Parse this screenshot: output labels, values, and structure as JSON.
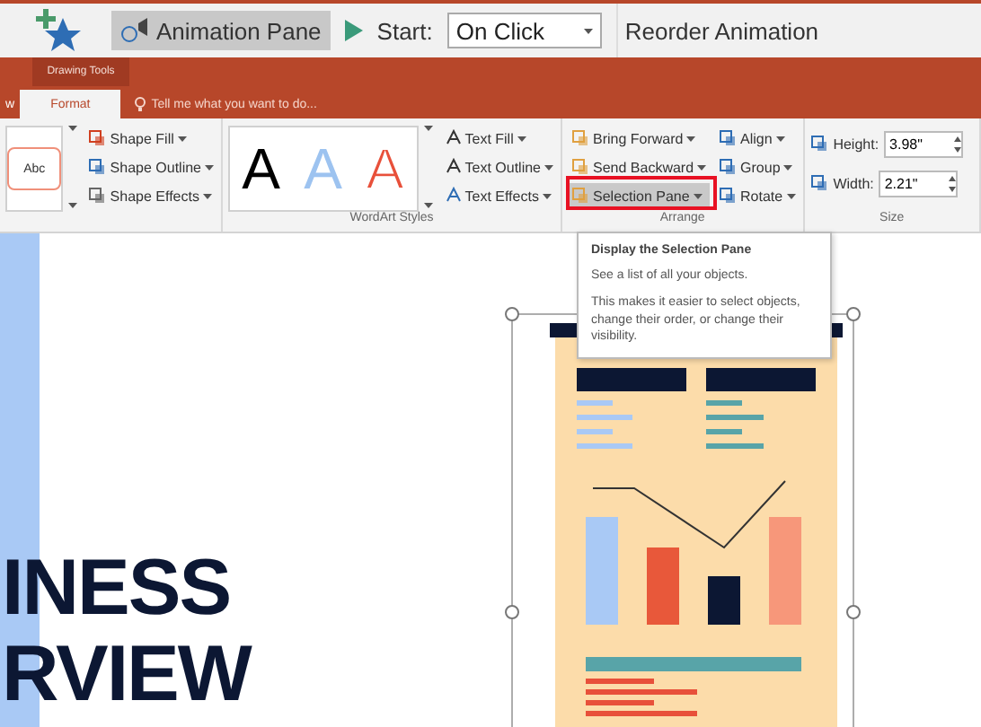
{
  "animations_bar": {
    "animation_pane": {
      "label": "Animation Pane",
      "selected": true
    },
    "start_label": "Start:",
    "start_value": "On Click",
    "reorder": "Reorder Animation"
  },
  "contextual_group": "Drawing Tools",
  "tabs": [
    {
      "label": "w",
      "selected": false
    },
    {
      "label": "Format",
      "selected": true
    }
  ],
  "tell_me": {
    "placeholder": "Tell me what you want to do..."
  },
  "shape_styles": {
    "preview": "Abc",
    "commands": [
      "Shape Fill",
      "Shape Outline",
      "Shape Effects"
    ]
  },
  "wordart": {
    "samples": [
      {
        "letter": "A",
        "kind": "solid",
        "color": "#000000"
      },
      {
        "letter": "A",
        "kind": "solid",
        "color": "#9dc3f0"
      },
      {
        "letter": "A",
        "kind": "outline",
        "color": "#e8503a"
      }
    ],
    "commands": [
      "Text Fill",
      "Text Outline",
      "Text Effects"
    ],
    "group": "WordArt Styles"
  },
  "arrange": {
    "commands": [
      {
        "label": "Bring Forward",
        "selected": false
      },
      {
        "label": "Send Backward",
        "selected": false
      },
      {
        "label": "Selection Pane",
        "selected": true
      }
    ],
    "commands_2": [
      "Align",
      "Group",
      "Rotate"
    ],
    "group": "Arrange"
  },
  "size": {
    "fields": [
      {
        "label": "Height:",
        "value": "3.98\""
      },
      {
        "label": "Width:",
        "value": "2.21\""
      }
    ],
    "group": "Size"
  },
  "tooltip": {
    "title": "Display the Selection Pane",
    "lines": [
      "See a list of all your objects.",
      "This makes it easier to select objects, change their order, or change their visibility."
    ]
  },
  "slide": {
    "title_lines": [
      "INESS",
      "RVIEW"
    ]
  }
}
